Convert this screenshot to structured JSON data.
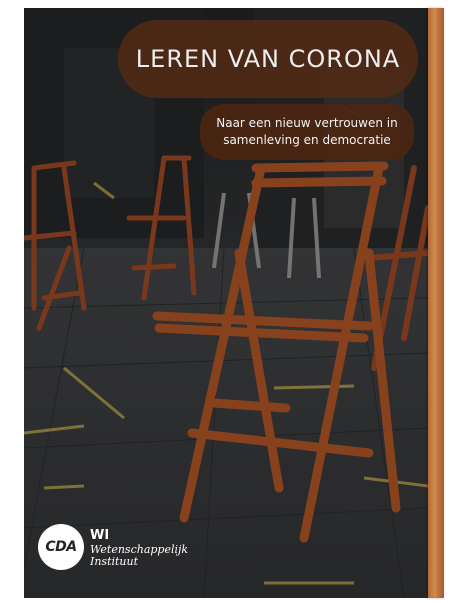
{
  "cover": {
    "title": "LEREN VAN CORONA",
    "subtitle_line1": "Naar een nieuw vertrouwen in",
    "subtitle_line2": "samenleving en democratie",
    "logo_text": "CDA",
    "institute_abbr": "WI",
    "institute_line1": "Wetenschappelijk",
    "institute_line2": "Instituut",
    "colors": {
      "title_band": "#4f2a16",
      "chair_wood": "#9a4a22",
      "spine": "#c07a44",
      "floor_marking": "#b8a24a"
    }
  }
}
